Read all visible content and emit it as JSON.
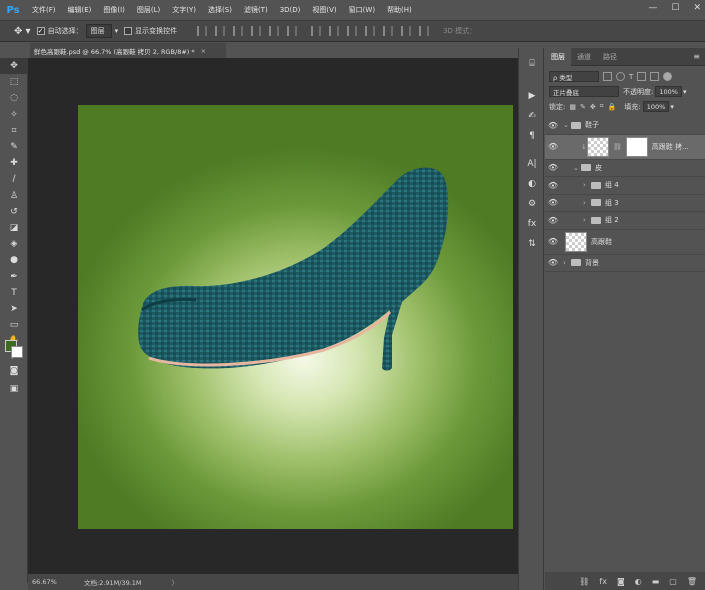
{
  "app": {
    "logo": "Ps"
  },
  "menu": [
    "文件(F)",
    "编辑(E)",
    "图像(I)",
    "图层(L)",
    "文字(Y)",
    "选择(S)",
    "滤镜(T)",
    "3D(D)",
    "视图(V)",
    "窗口(W)",
    "帮助(H)"
  ],
  "window_controls": {
    "minimize": "—",
    "maximize": "☐",
    "close": "✕"
  },
  "options": {
    "auto_select_label": "自动选择：",
    "auto_select_value": "图层",
    "show_transform_label": "显示变换控件",
    "mode_3d": "3D 模式："
  },
  "document": {
    "tab_title": "鲜色高跟鞋.psd @ 66.7% (高跟鞋 拷贝 2, RGB/8#) *",
    "close": "×"
  },
  "colors": {
    "foreground": "#3f6b20",
    "background": "#ffffff",
    "accent": "#31a8ff"
  },
  "status": {
    "zoom": "66.67%",
    "doc_size": "文档:2.91M/39.1M",
    "arrow": "〉"
  },
  "panel": {
    "tabs": [
      "图层",
      "通道",
      "路径"
    ],
    "kind_label": "ρ 类型",
    "blend_mode": "正片叠底",
    "opacity_label": "不透明度:",
    "opacity_value": "100%",
    "lock_label": "锁定:",
    "fill_label": "填充:",
    "fill_value": "100%",
    "layers": [
      {
        "name": "鞋子",
        "type": "group",
        "expanded": true,
        "depth": 0
      },
      {
        "name": "高跟鞋 拷...",
        "type": "layer-mask",
        "depth": 1,
        "selected": true
      },
      {
        "name": "皮",
        "type": "group",
        "expanded": true,
        "depth": 1
      },
      {
        "name": "组 4",
        "type": "group",
        "expanded": false,
        "depth": 2
      },
      {
        "name": "组 3",
        "type": "group",
        "expanded": false,
        "depth": 2
      },
      {
        "name": "组 2",
        "type": "group",
        "expanded": false,
        "depth": 2
      },
      {
        "name": "高跟鞋",
        "type": "layer",
        "depth": 0
      },
      {
        "name": "背景",
        "type": "group",
        "expanded": false,
        "depth": 0
      }
    ]
  }
}
